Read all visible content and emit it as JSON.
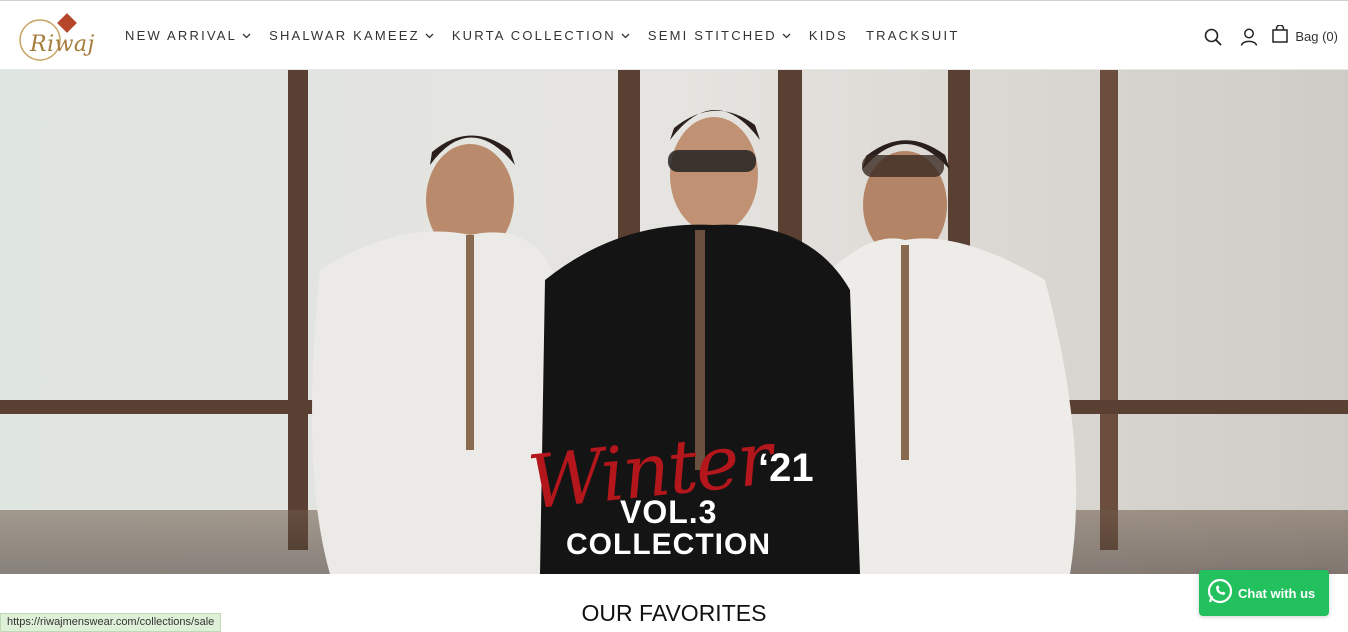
{
  "brand": {
    "logo_text": "Riwaj"
  },
  "nav": [
    {
      "label": "NEW ARRIVAL",
      "has_dropdown": true
    },
    {
      "label": "SHALWAR KAMEEZ",
      "has_dropdown": true
    },
    {
      "label": "KURTA COLLECTION",
      "has_dropdown": true
    },
    {
      "label": "SEMI STITCHED",
      "has_dropdown": true
    },
    {
      "label": "KIDS",
      "has_dropdown": false
    },
    {
      "label": "TRACKSUIT",
      "has_dropdown": false
    }
  ],
  "header_icons": [
    "search-icon",
    "user-icon",
    "bag-icon"
  ],
  "bag": {
    "label": "Bag (0)"
  },
  "hero": {
    "script_word": "Winter",
    "year": "‘21",
    "line1": "VOL.3",
    "line2": "COLLECTION"
  },
  "section": {
    "title": "OUR FAVORITES"
  },
  "status_bar": {
    "url": "https://riwajmenswear.com/collections/sale"
  },
  "chat": {
    "label": "Chat with us"
  },
  "colors": {
    "accent_gold": "#a67c3d",
    "hero_red": "#b3161b",
    "whatsapp_green": "#22c15e"
  }
}
